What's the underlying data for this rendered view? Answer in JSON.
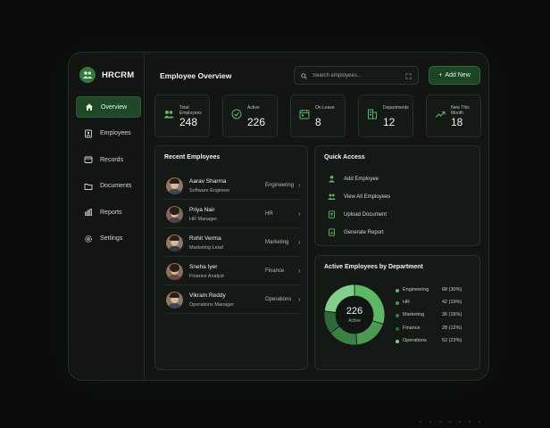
{
  "brand": {
    "name": "HRCRM"
  },
  "nav": [
    {
      "label": "Overview",
      "icon": "home-icon",
      "active": true
    },
    {
      "label": "Employees",
      "icon": "employees-icon"
    },
    {
      "label": "Records",
      "icon": "records-icon"
    },
    {
      "label": "Documents",
      "icon": "folder-icon"
    },
    {
      "label": "Reports",
      "icon": "reports-icon"
    },
    {
      "label": "Settings",
      "icon": "gear-icon"
    }
  ],
  "header": {
    "title": "Employee Overview",
    "search_placeholder": "Search employees...",
    "add_label": "Add New"
  },
  "stats": [
    {
      "label": "Total Employees",
      "value": "248",
      "icon": "people-icon"
    },
    {
      "label": "Active",
      "value": "226",
      "icon": "check-circle-icon"
    },
    {
      "label": "On Leave",
      "value": "8",
      "icon": "calendar-icon"
    },
    {
      "label": "Departments",
      "value": "12",
      "icon": "building-icon"
    },
    {
      "label": "New This Month",
      "value": "18",
      "icon": "trend-up-icon"
    }
  ],
  "recent": {
    "title": "Recent Employees",
    "items": [
      {
        "name": "Aarav Sharma",
        "role": "Software Engineer",
        "dept": "Engineering"
      },
      {
        "name": "Priya Nair",
        "role": "HR Manager",
        "dept": "HR"
      },
      {
        "name": "Rohit Verma",
        "role": "Marketing Lead",
        "dept": "Marketing"
      },
      {
        "name": "Sneha Iyer",
        "role": "Finance Analyst",
        "dept": "Finance"
      },
      {
        "name": "Vikram Reddy",
        "role": "Operations Manager",
        "dept": "Operations"
      }
    ]
  },
  "quick": {
    "title": "Quick Access",
    "items": [
      {
        "label": "Add Employee",
        "icon": "user-add-icon"
      },
      {
        "label": "View All Employees",
        "icon": "users-icon"
      },
      {
        "label": "Upload Document",
        "icon": "upload-doc-icon"
      },
      {
        "label": "Generate Report",
        "icon": "report-doc-icon"
      }
    ]
  },
  "dept_chart": {
    "title": "Active Employees by Department",
    "center_value": "226",
    "center_label": "Active",
    "items": [
      {
        "name": "Engineering",
        "value": "68 (30%)",
        "count": 68,
        "color": "#5cb865"
      },
      {
        "name": "HR",
        "value": "42 (19%)",
        "count": 42,
        "color": "#4a9a54"
      },
      {
        "name": "Marketing",
        "value": "36 (16%)",
        "count": 36,
        "color": "#3a8044"
      },
      {
        "name": "Finance",
        "value": "28 (12%)",
        "count": 28,
        "color": "#2e6a37"
      },
      {
        "name": "Operations",
        "value": "52 (23%)",
        "count": 52,
        "color": "#7ed08a"
      }
    ]
  }
}
